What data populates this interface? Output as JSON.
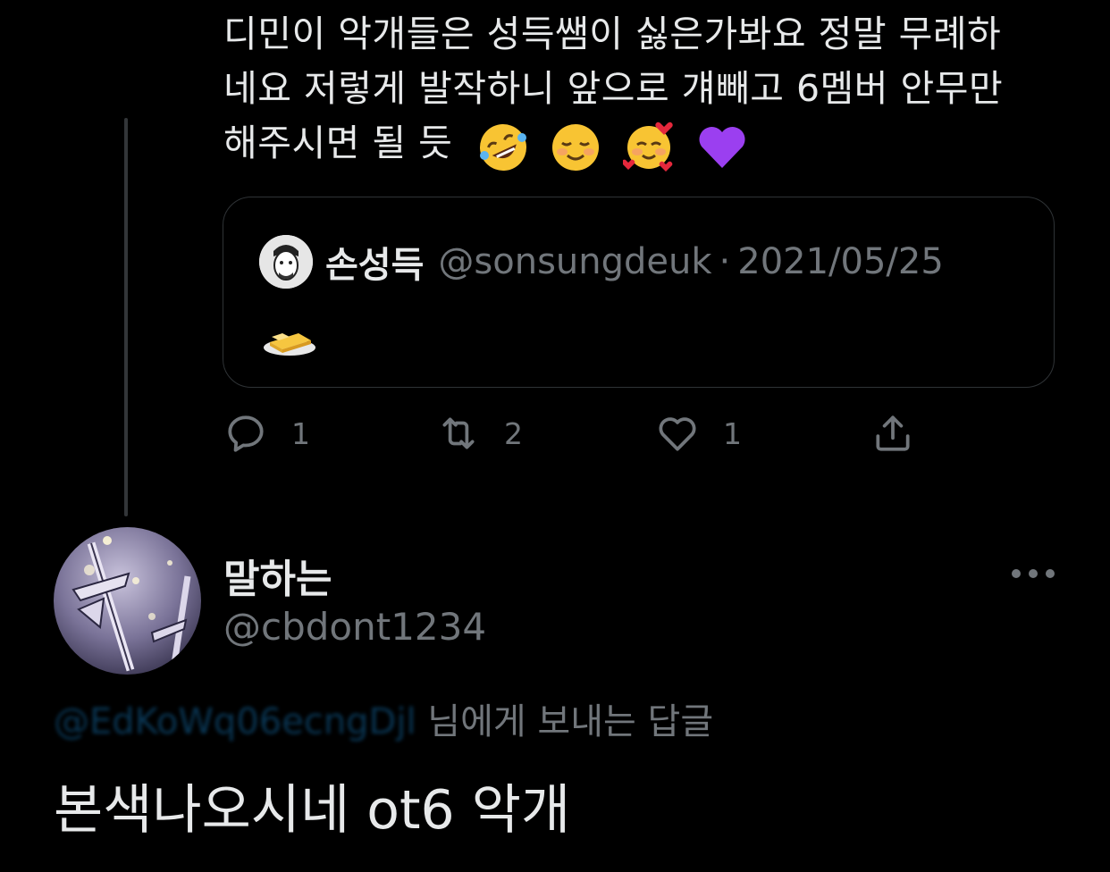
{
  "tweet": {
    "text_line1": "디민이 악개들은 성득쌤이 싫은가봐요 정말 무례하",
    "text_line2": "네요 저렇게 발작하니 앞으로 걔빼고 6멤버 안무만",
    "text_line3": "해주시면 될 듯",
    "emojis": [
      "rofl-emoji",
      "smiling-face-emoji",
      "smiling-hearts-emoji",
      "purple-heart-emoji"
    ]
  },
  "quote": {
    "name": "손성득",
    "handle": "@sonsungdeuk",
    "separator": "·",
    "date": "2021/05/25",
    "body_icon": "butter-emoji"
  },
  "actions": {
    "reply_count": "1",
    "retweet_count": "2",
    "like_count": "1",
    "icons": [
      "reply-icon",
      "retweet-icon",
      "like-icon",
      "share-icon"
    ]
  },
  "reply": {
    "name": "말하는",
    "handle": "@cbdont1234",
    "replying_to_mention": "@EdKoWq06ecngDjl",
    "replying_to_suffix": " 님에게 보내는 답글",
    "text": "본색나오시네 ot6 악개"
  },
  "colors": {
    "background": "#000000",
    "text": "#e7e9ea",
    "muted": "#71767b",
    "border": "#2f3336",
    "accent": "#1d9bf0"
  }
}
